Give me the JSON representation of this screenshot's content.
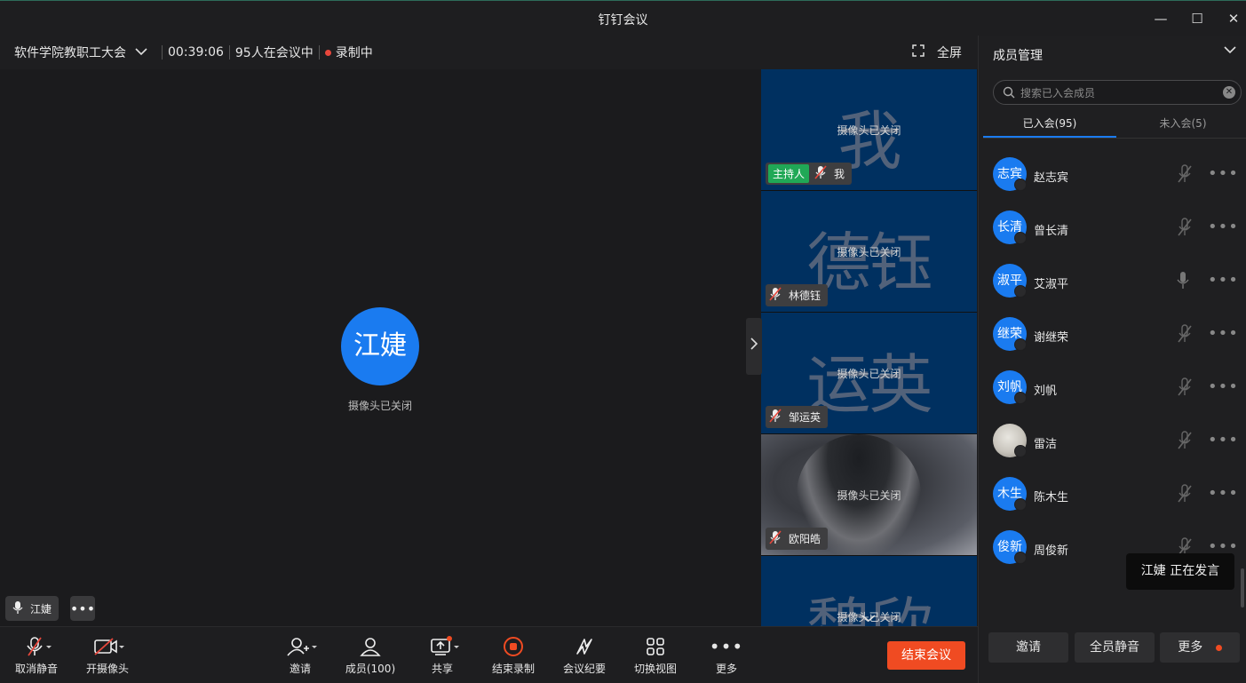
{
  "window": {
    "title": "钉钉会议"
  },
  "meeting": {
    "name": "软件学院教职工大会",
    "duration": "00:39:06",
    "count_text": "95人在会议中",
    "recording_text": "录制中",
    "fullscreen_label": "全屏"
  },
  "stage": {
    "avatar_text": "江婕",
    "camera_off": "摄像头已关闭",
    "speaker_name": "江婕"
  },
  "tiles": [
    {
      "watermark": "我",
      "camera_off": "摄像头已关闭",
      "name": "我",
      "host_tag": "主持人"
    },
    {
      "watermark": "德钰",
      "camera_off": "摄像头已关闭",
      "name": "林德钰"
    },
    {
      "watermark": "运英",
      "camera_off": "摄像头已关闭",
      "name": "邹运英"
    },
    {
      "watermark": "",
      "camera_off": "摄像头已关闭",
      "name": "欧阳皓"
    },
    {
      "watermark": "魏欣",
      "camera_off": "摄像头已关闭",
      "name": ""
    }
  ],
  "toolbar": {
    "mute": "取消静音",
    "camera": "开摄像头",
    "invite": "邀请",
    "members": "成员(100)",
    "share": "共享",
    "stop_record": "结束录制",
    "minutes": "会议纪要",
    "switch_view": "切换视图",
    "more": "更多",
    "end_meeting": "结束会议"
  },
  "panel": {
    "title": "成员管理",
    "search_placeholder": "搜索已入会成员",
    "tab_joined": "已入会(95)",
    "tab_not_joined": "未入会(5)",
    "members": [
      {
        "avatar": "志宾",
        "name": "赵志宾",
        "muted": true
      },
      {
        "avatar": "长清",
        "name": "曾长清",
        "muted": true
      },
      {
        "avatar": "淑平",
        "name": "艾淑平",
        "muted": false
      },
      {
        "avatar": "继荣",
        "name": "谢继荣",
        "muted": true
      },
      {
        "avatar": "刘帆",
        "name": "刘帆",
        "muted": true
      },
      {
        "avatar": "",
        "name": "雷洁",
        "muted": true
      },
      {
        "avatar": "木生",
        "name": "陈木生",
        "muted": true
      },
      {
        "avatar": "俊新",
        "name": "周俊新",
        "muted": true
      }
    ],
    "tooltip": "江婕  正在发言",
    "btn_invite": "邀请",
    "btn_mute_all": "全员静音",
    "btn_more": "更多"
  },
  "colors": {
    "accent": "#1a7bf0",
    "danger": "#f04b22",
    "host": "#20a856",
    "tile_bg": "#003060"
  }
}
